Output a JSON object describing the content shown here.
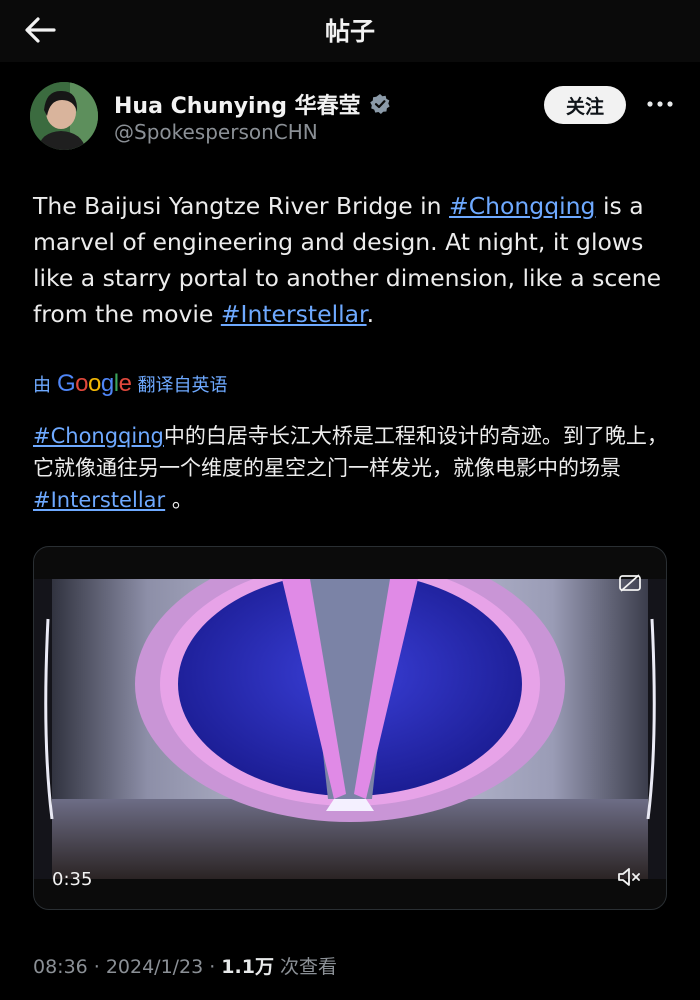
{
  "header": {
    "title": "帖子",
    "back_icon": "arrow-left-icon"
  },
  "author": {
    "display_name": "Hua Chunying 华春莹",
    "handle": "@SpokespersonCHN",
    "verified_icon": "verified-badge-icon",
    "follow_label": "关注",
    "more_icon": "more-horizontal-icon"
  },
  "tweet": {
    "text_1": "The Baijusi Yangtze River Bridge in ",
    "hashtag_1": "#Chongqing",
    "text_2": " is a marvel of engineering and design. At night, it glows like a starry portal to another dimension, like a scene from the movie ",
    "hashtag_2": "#Interstellar",
    "text_3": "."
  },
  "translation": {
    "by_label": "由",
    "google_g1": "G",
    "google_o1": "o",
    "google_o2": "o",
    "google_g2": "g",
    "google_l": "l",
    "google_e": "e",
    "translated_from": "翻译自英语",
    "hashtag_1": "#Chongqing",
    "text_1": "中的白居寺长江大桥是工程和设计的奇迹。到了晚上，它就像通往另一个维度的星空之门一样发光，就像电影中的场景",
    "hashtag_2": "#Interstellar",
    "text_2": " 。"
  },
  "media": {
    "time": "0:35",
    "mute_icon": "volume-mute-icon",
    "caption_icon": "closed-caption-off-icon"
  },
  "meta": {
    "time": "08:36",
    "sep_1": "·",
    "date": "2024/1/23",
    "sep_2": "·",
    "views": "1.1万",
    "views_label": "次查看"
  }
}
